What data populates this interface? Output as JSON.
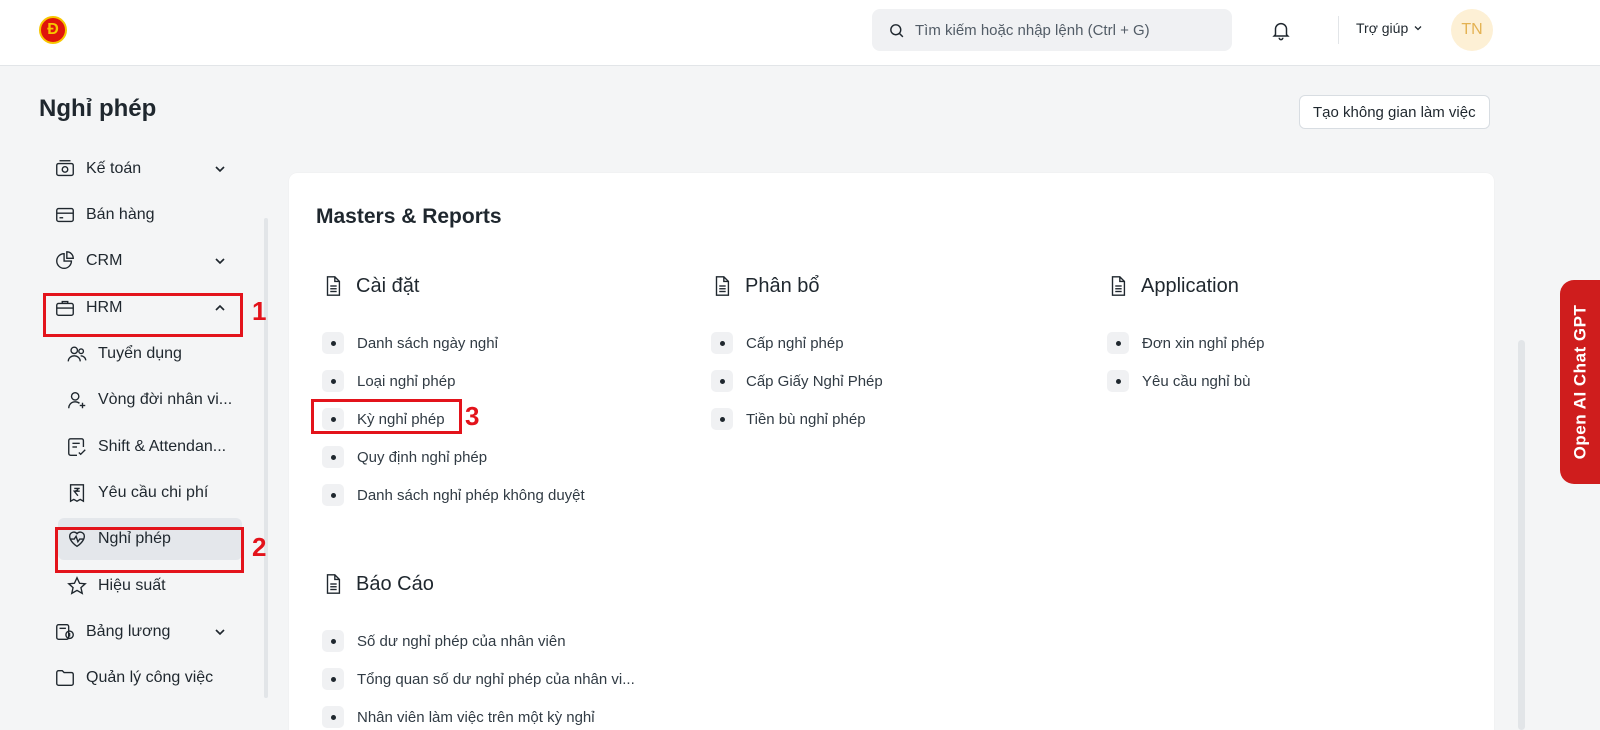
{
  "navbar": {
    "logo_letter": "Đ",
    "search_placeholder": "Tìm kiếm hoặc nhập lệnh (Ctrl + G)",
    "help_label": "Trợ giúp",
    "avatar_initials": "TN"
  },
  "page": {
    "title": "Nghỉ phép",
    "workspace_button": "Tạo không gian làm việc"
  },
  "sidebar": {
    "items": [
      {
        "label": "Kế toán",
        "icon": "accounting-icon",
        "expandable": true
      },
      {
        "label": "Bán hàng",
        "icon": "card-icon",
        "expandable": false
      },
      {
        "label": "CRM",
        "icon": "pie-chart-icon",
        "expandable": true
      },
      {
        "label": "HRM",
        "icon": "briefcase-icon",
        "expandable": true,
        "expanded": true
      },
      {
        "label": "Tuyển dụng",
        "icon": "users-icon"
      },
      {
        "label": "Vòng đời nhân vi...",
        "icon": "user-plus-icon"
      },
      {
        "label": "Shift & Attendan...",
        "icon": "checklist-icon"
      },
      {
        "label": "Yêu cầu chi phí",
        "icon": "rupee-receipt-icon"
      },
      {
        "label": "Nghỉ phép",
        "icon": "heart-pulse-icon",
        "active": true
      },
      {
        "label": "Hiệu suất",
        "icon": "star-icon"
      },
      {
        "label": "Bảng lương",
        "icon": "payroll-icon",
        "expandable": true
      },
      {
        "label": "Quản lý công việc",
        "icon": "folder-icon",
        "expandable": false
      }
    ]
  },
  "annotations": [
    "1",
    "2",
    "3"
  ],
  "main": {
    "title": "Masters & Reports",
    "sections": [
      {
        "title": "Cài đặt",
        "links": [
          "Danh sách ngày nghỉ",
          "Loại nghỉ phép",
          "Kỳ nghỉ phép",
          "Quy định nghỉ phép",
          "Danh sách nghỉ phép không duyệt"
        ]
      },
      {
        "title": "Phân bổ",
        "links": [
          "Cấp nghỉ phép",
          "Cấp Giấy Nghỉ Phép",
          "Tiền bù nghỉ phép"
        ]
      },
      {
        "title": "Application",
        "links": [
          "Đơn xin nghỉ phép",
          "Yêu cầu nghỉ bù"
        ]
      },
      {
        "title": "Báo Cáo",
        "links": [
          "Số dư nghỉ phép của nhân viên",
          "Tổng quan số dư nghỉ phép của nhân vi...",
          "Nhân viên làm việc trên một kỳ nghỉ"
        ]
      }
    ]
  },
  "gpt_tab": "Open AI Chat GPT",
  "colors": {
    "accent_red": "#e3131b",
    "gpt_tab": "#cf1d1d",
    "avatar_bg": "#fdf0d5",
    "avatar_text": "#e4b252"
  }
}
